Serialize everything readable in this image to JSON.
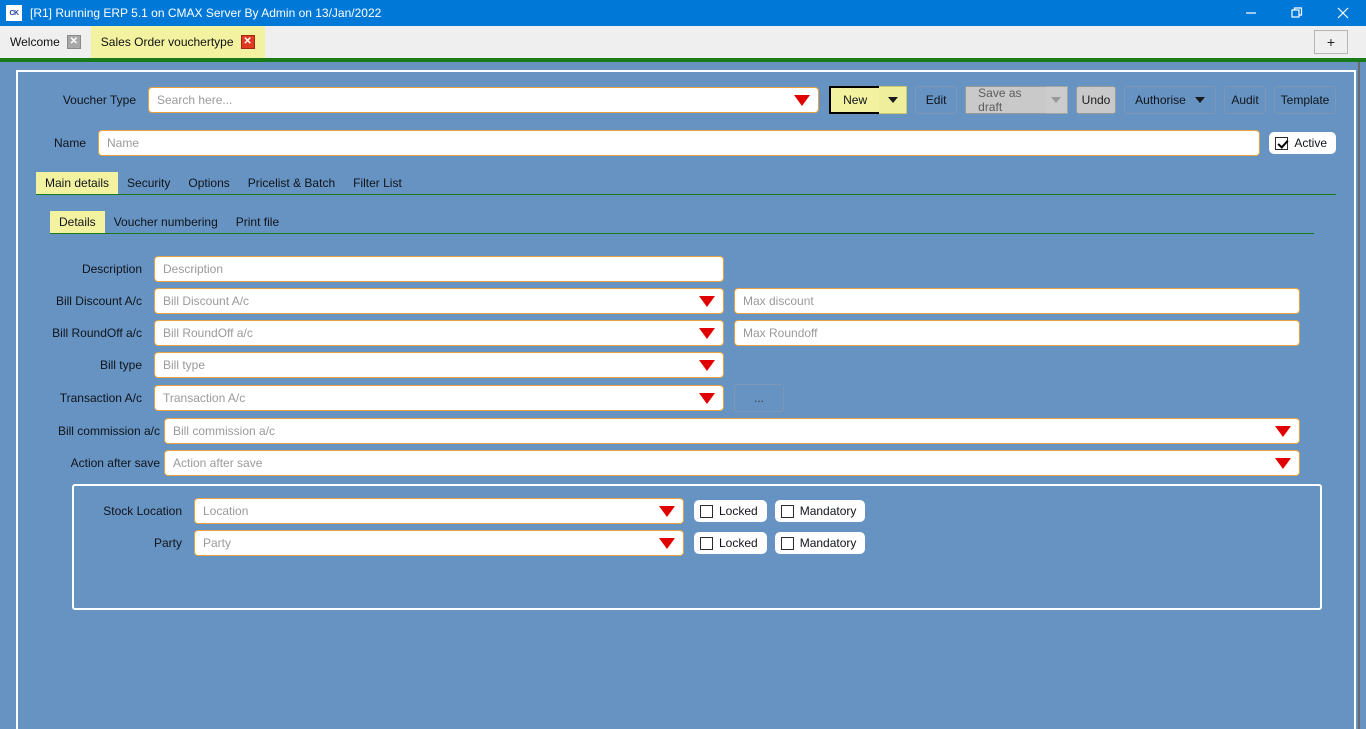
{
  "window": {
    "title": "[R1] Running ERP 5.1 on CMAX Server By Admin on 13/Jan/2022",
    "app_icon": "CK",
    "minimize_label": "—",
    "maximize_label": "❐",
    "close_label": "✕",
    "accent_color": "#0078d7",
    "panel_color": "#6693c2",
    "accent_green": "#1a7a1a",
    "tab_yellow": "#f2f2a0",
    "field_border": "#e8a33d",
    "caret_red": "#e00000"
  },
  "doc_tabs": {
    "items": [
      {
        "label": "Welcome",
        "active": false,
        "close_label": "✕"
      },
      {
        "label": "Sales Order vouchertype",
        "active": true,
        "close_label": "✕"
      }
    ],
    "new_tab_label": "+"
  },
  "header": {
    "voucher_type_label": "Voucher Type",
    "voucher_type_placeholder": "Search here...",
    "name_label": "Name",
    "name_placeholder": "Name",
    "active_label": "Active",
    "active_checked": true
  },
  "toolbar": {
    "new_label": "New",
    "edit_label": "Edit",
    "save_as_draft_label": "Save as draft",
    "undo_label": "Undo",
    "authorise_label": "Authorise",
    "audit_label": "Audit",
    "template_label": "Template"
  },
  "main_tabs": {
    "items": [
      {
        "label": "Main details",
        "selected": true
      },
      {
        "label": "Security",
        "selected": false
      },
      {
        "label": "Options",
        "selected": false
      },
      {
        "label": "Pricelist & Batch",
        "selected": false
      },
      {
        "label": "Filter List",
        "selected": false
      }
    ]
  },
  "sub_tabs": {
    "items": [
      {
        "label": "Details",
        "selected": true
      },
      {
        "label": "Voucher numbering",
        "selected": false
      },
      {
        "label": "Print file",
        "selected": false
      }
    ]
  },
  "form": {
    "description": {
      "label": "Description",
      "placeholder": "Description"
    },
    "bill_discount": {
      "label": "Bill Discount A/c",
      "placeholder": "Bill Discount A/c"
    },
    "max_discount": {
      "placeholder": "Max discount"
    },
    "bill_roundoff": {
      "label": "Bill RoundOff a/c",
      "placeholder": "Bill RoundOff a/c"
    },
    "max_roundoff": {
      "placeholder": "Max Roundoff"
    },
    "bill_type": {
      "label": "Bill type",
      "placeholder": "Bill type"
    },
    "transaction_ac": {
      "label": "Transaction A/c",
      "placeholder": "Transaction A/c"
    },
    "ellipsis_button_label": "...",
    "bill_commission": {
      "label": "Bill commission a/c",
      "placeholder": "Bill commission a/c"
    },
    "action_after_save": {
      "label": "Action after save",
      "placeholder": "Action after save"
    }
  },
  "group": {
    "stock_location": {
      "label": "Stock Location",
      "placeholder": "Location",
      "locked_label": "Locked",
      "locked_checked": false,
      "mandatory_label": "Mandatory",
      "mandatory_checked": false
    },
    "party": {
      "label": "Party",
      "placeholder": "Party",
      "locked_label": "Locked",
      "locked_checked": false,
      "mandatory_label": "Mandatory",
      "mandatory_checked": false
    }
  }
}
